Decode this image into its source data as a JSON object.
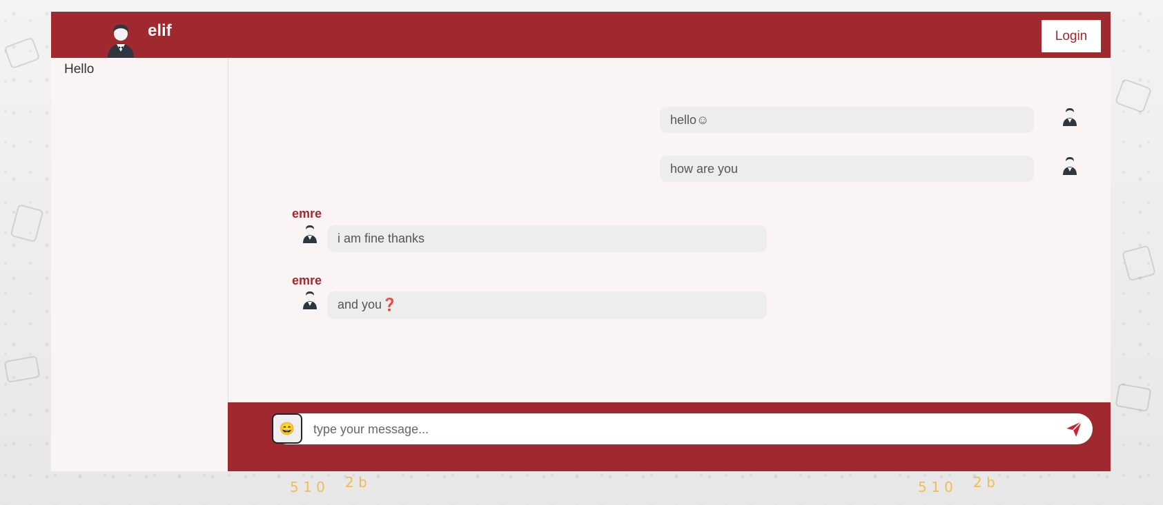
{
  "header": {
    "username": "elif",
    "login_label": "Login"
  },
  "sidebar": {
    "items": [
      {
        "label": "Hello"
      }
    ]
  },
  "messages": [
    {
      "text": "hello☺",
      "side": "right"
    },
    {
      "text": "how are you",
      "side": "right"
    },
    {
      "sender": "emre",
      "text": "i am fine thanks",
      "side": "left"
    },
    {
      "sender": "emre",
      "text": "and you❓",
      "side": "left"
    }
  ],
  "composer": {
    "placeholder": "type your message...",
    "emoji_glyph": "😄",
    "emoji_icon": "emoji-icon",
    "send_icon": "send-icon"
  },
  "colors": {
    "brand": "#a0292f",
    "bubble": "#ededed",
    "panel": "#fbf4f4"
  }
}
